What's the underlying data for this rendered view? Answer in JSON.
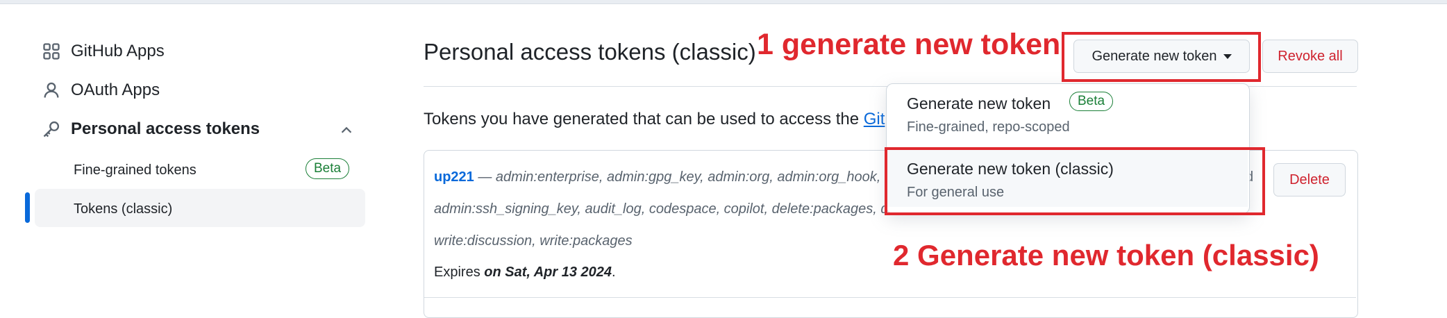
{
  "sidebar": {
    "items": [
      {
        "label": "GitHub Apps",
        "icon": "apps-grid-icon"
      },
      {
        "label": "OAuth Apps",
        "icon": "person-icon"
      },
      {
        "label": "Personal access tokens",
        "icon": "key-icon"
      }
    ],
    "sub_items": [
      {
        "label": "Fine-grained tokens",
        "badge": "Beta"
      },
      {
        "label": "Tokens (classic)",
        "active": true
      }
    ]
  },
  "main": {
    "title": "Personal access tokens (classic)",
    "generate_button": "Generate new token",
    "revoke_button": "Revoke all",
    "description_start": "Tokens you have generated that can be used to access the ",
    "description_link": "Git"
  },
  "dropdown": {
    "items": [
      {
        "title": "Generate new token",
        "badge": "Beta",
        "description": "Fine-grained, repo-scoped"
      },
      {
        "title": "Generate new token (classic)",
        "description": "For general use"
      }
    ]
  },
  "token": {
    "name": "up221",
    "scopes_line1": " — admin:enterprise, admin:gpg_key, admin:org, admin:org_hook,",
    "scopes_line2": "admin:ssh_signing_key, audit_log, codespace, copilot, delete:packages, de",
    "scopes_line3": "write:discussion, write:packages",
    "trailing_text": "d",
    "expires_label": "Expires ",
    "expires_value": "on Sat, Apr 13 2024",
    "expires_end": ".",
    "delete_button": "Delete"
  },
  "annotations": {
    "step1": "1 generate new token",
    "step2": "2 Generate new token (classic)",
    "color": "#e0282e"
  },
  "colors": {
    "accent": "#0969da",
    "danger": "#cf222e",
    "success": "#1a7f37"
  }
}
